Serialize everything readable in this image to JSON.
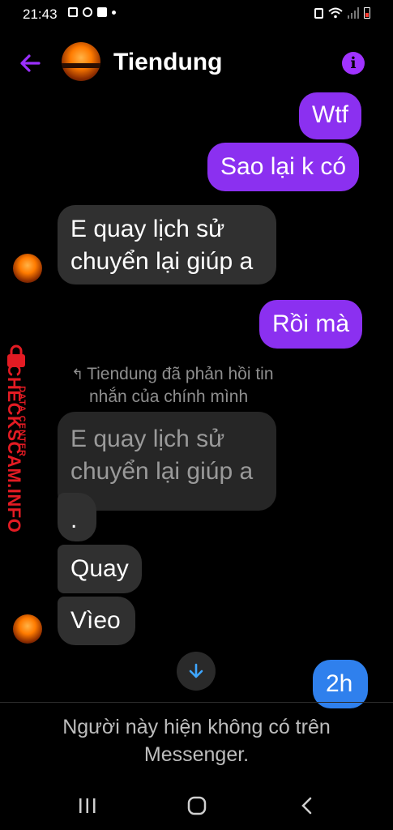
{
  "status_bar": {
    "time": "21:43"
  },
  "header": {
    "contact_name": "Tiendung",
    "info_glyph": "i",
    "back_icon": "back-arrow-icon",
    "accent_color": "#9b30ff"
  },
  "messages": [
    {
      "id": "m1",
      "side": "out",
      "text": "Wtf"
    },
    {
      "id": "m2",
      "side": "out",
      "text": "Sao lại k có"
    },
    {
      "id": "m3",
      "side": "in",
      "line1": "E quay lịch sử",
      "line2": "chuyển lại giúp a"
    },
    {
      "id": "m4",
      "side": "out",
      "text": "Rồi mà"
    },
    {
      "id": "m5",
      "side": "in",
      "line1": "E quay lịch sử",
      "line2": "chuyển lại giúp a",
      "faded": true
    },
    {
      "id": "m6",
      "side": "in",
      "text": "."
    },
    {
      "id": "m7",
      "side": "in",
      "text": "Quay"
    },
    {
      "id": "m8",
      "side": "in",
      "text": "Vìeo"
    },
    {
      "id": "m9",
      "side": "out",
      "text": "2h"
    }
  ],
  "reply_label": {
    "line1": "Tiendung đã phản hồi tin",
    "line2": "nhắn của chính mình"
  },
  "watermark": {
    "main": "CHECKSCAM.INFO",
    "sub": "DATA CENTER"
  },
  "notice": {
    "line1": "Người này hiện không có trên",
    "line2": "Messenger."
  },
  "colors": {
    "outgoing_bubble": "#8b30f0",
    "incoming_bubble": "#303030",
    "background": "#000000"
  }
}
